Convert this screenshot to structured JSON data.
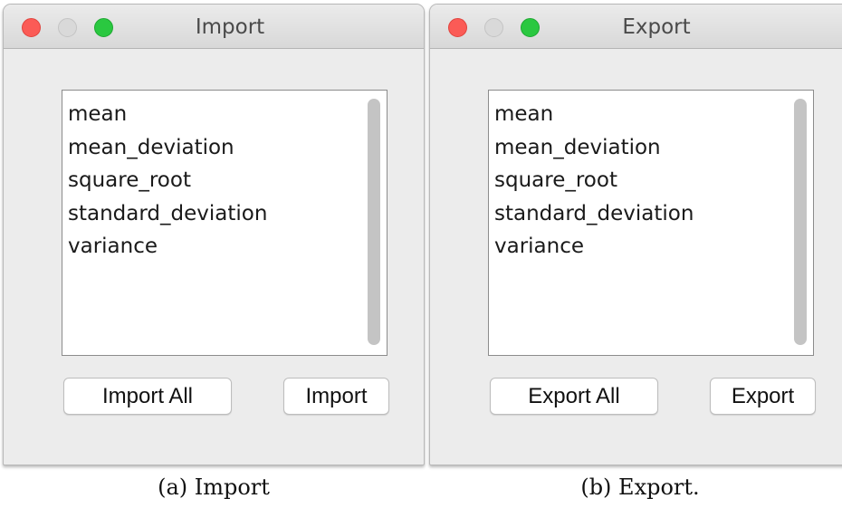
{
  "panels": [
    {
      "window_title": "Import",
      "list_items": [
        "mean",
        "mean_deviation",
        "square_root",
        "standard_deviation",
        "variance"
      ],
      "all_button_label": "Import All",
      "single_button_label": "Import",
      "caption": "(a) Import"
    },
    {
      "window_title": "Export",
      "list_items": [
        "mean",
        "mean_deviation",
        "square_root",
        "standard_deviation",
        "variance"
      ],
      "all_button_label": "Export All",
      "single_button_label": "Export",
      "caption": "(b) Export."
    }
  ],
  "colors": {
    "close": "#fb5b56",
    "minimize": "#d9d9d9",
    "zoom": "#2ac840"
  }
}
